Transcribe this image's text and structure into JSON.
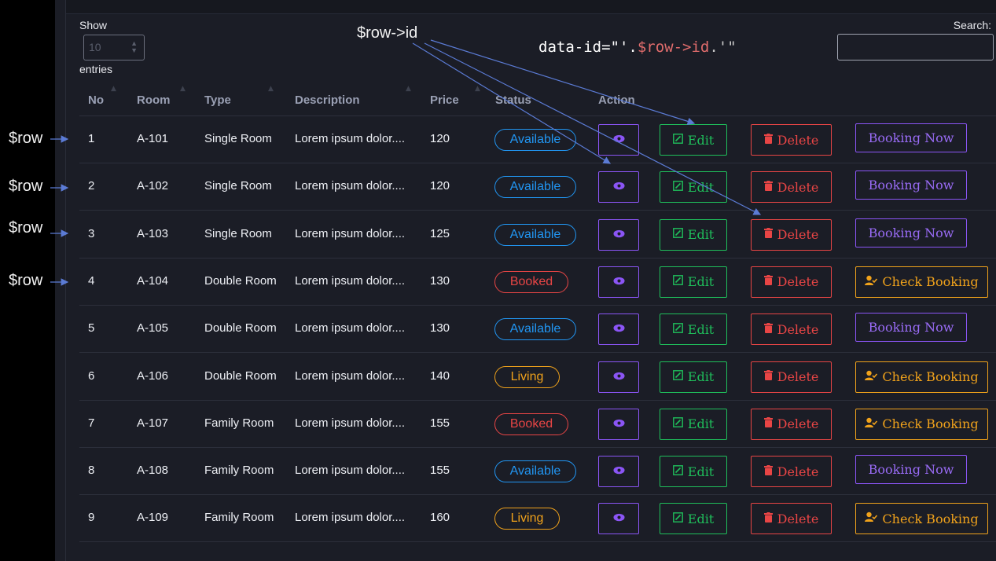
{
  "colors": {
    "background": "#1b1d26",
    "available": "#2196f3",
    "booked": "#e84545",
    "living": "#f0a21b",
    "view": "#8b55f5",
    "edit": "#1fbf5b",
    "delete": "#e84545",
    "booking_now": "#8b55f5",
    "check_booking": "#f0a21b",
    "annotation_arrow": "#5b7bd5"
  },
  "controls": {
    "show_label": "Show",
    "length_value": "10",
    "entries_label": "entries",
    "search_label": "Search:"
  },
  "annotations": {
    "row_id": "$row->id",
    "code_prefix": "data-id=\"'.",
    "code_var": "$row->id",
    "code_suffix": ".'\"",
    "row_label": "$row"
  },
  "table": {
    "columns": [
      "No",
      "Room",
      "Type",
      "Description",
      "Price",
      "Status",
      "Action"
    ],
    "rows": [
      {
        "no": "1",
        "room": "A-101",
        "type": "Single Room",
        "description": "Lorem ipsum dolor....",
        "price": "120",
        "status": "Available"
      },
      {
        "no": "2",
        "room": "A-102",
        "type": "Single Room",
        "description": "Lorem ipsum dolor....",
        "price": "120",
        "status": "Available"
      },
      {
        "no": "3",
        "room": "A-103",
        "type": "Single Room",
        "description": "Lorem ipsum dolor....",
        "price": "125",
        "status": "Available"
      },
      {
        "no": "4",
        "room": "A-104",
        "type": "Double Room",
        "description": "Lorem ipsum dolor....",
        "price": "130",
        "status": "Booked"
      },
      {
        "no": "5",
        "room": "A-105",
        "type": "Double Room",
        "description": "Lorem ipsum dolor....",
        "price": "130",
        "status": "Available"
      },
      {
        "no": "6",
        "room": "A-106",
        "type": "Double Room",
        "description": "Lorem ipsum dolor....",
        "price": "140",
        "status": "Living"
      },
      {
        "no": "7",
        "room": "A-107",
        "type": "Family Room",
        "description": "Lorem ipsum dolor....",
        "price": "155",
        "status": "Booked"
      },
      {
        "no": "8",
        "room": "A-108",
        "type": "Family Room",
        "description": "Lorem ipsum dolor....",
        "price": "155",
        "status": "Available"
      },
      {
        "no": "9",
        "room": "A-109",
        "type": "Family Room",
        "description": "Lorem ipsum dolor....",
        "price": "160",
        "status": "Living"
      }
    ]
  },
  "actions": {
    "view_icon": "eye-icon",
    "edit_label": "Edit",
    "edit_icon": "edit-square-icon",
    "delete_label": "Delete",
    "delete_icon": "trash-icon",
    "booking_now_label": "Booking Now",
    "check_booking_label": "Check Booking",
    "check_booking_icon": "user-check-icon"
  }
}
